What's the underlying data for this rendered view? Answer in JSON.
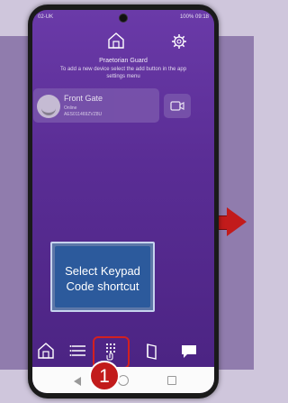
{
  "status_bar": {
    "left_text": "02-UK",
    "right_text": "100% 09:18"
  },
  "app": {
    "title": "Praetorian Guard",
    "subtitle": "To add a new device select the add button in the app settings menu"
  },
  "device": {
    "name": "Front Gate",
    "status": "Online",
    "id": "AES011469ZVZ8U"
  },
  "callout": {
    "line1": "Select Keypad",
    "line2": "Code shortcut"
  },
  "step": {
    "number": "1"
  },
  "colors": {
    "accent_red": "#c21b1b",
    "app_purple": "#5a2d95",
    "callout_blue": "#2c5a9c"
  }
}
